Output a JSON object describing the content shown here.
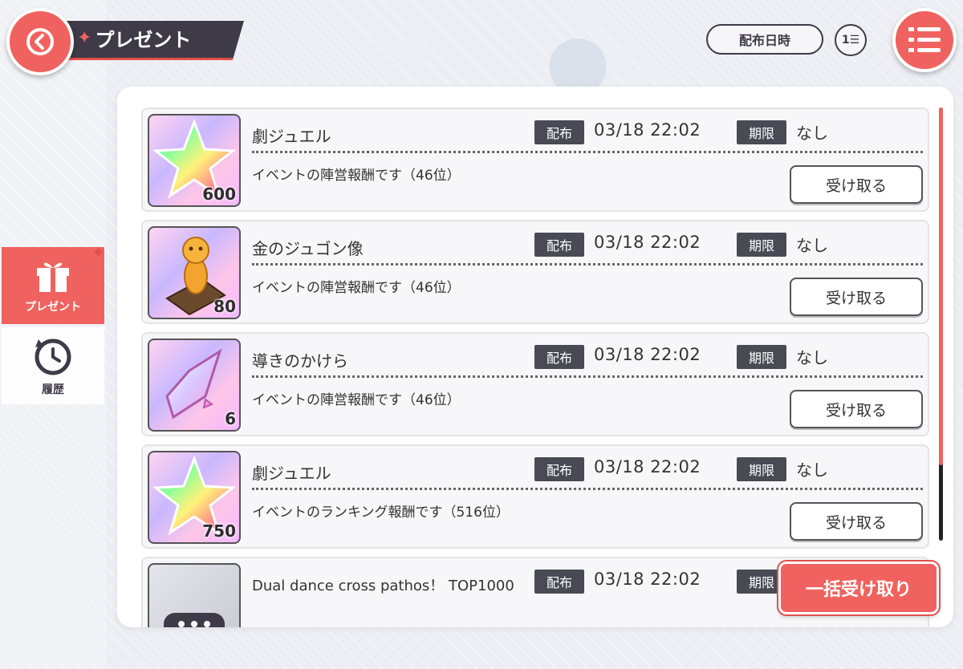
{
  "header": {
    "title": "プレゼント",
    "sort_label": "配布日時",
    "order_label": "1☰"
  },
  "sidebar": {
    "items": [
      {
        "label": "プレゼント",
        "icon": "gift-icon",
        "active": true
      },
      {
        "label": "履歴",
        "icon": "history-icon",
        "active": false
      }
    ]
  },
  "labels": {
    "distribution_tag": "配布",
    "limit_tag": "期限",
    "receive_button": "受け取る",
    "bulk_receive_button": "一括受け取り"
  },
  "presents": [
    {
      "name": "劇ジュエル",
      "quantity": "600",
      "date": "03/18 22:02",
      "limit": "なし",
      "description": "イベントの陣営報酬です（46位）",
      "icon": "star-jewel-icon"
    },
    {
      "name": "金のジュゴン像",
      "quantity": "80",
      "date": "03/18 22:02",
      "limit": "なし",
      "description": "イベントの陣営報酬です（46位）",
      "icon": "gold-dugong-statue-icon"
    },
    {
      "name": "導きのかけら",
      "quantity": "6",
      "date": "03/18 22:02",
      "limit": "なし",
      "description": "イベントの陣営報酬です（46位）",
      "icon": "crystal-shard-icon"
    },
    {
      "name": "劇ジュエル",
      "quantity": "750",
      "date": "03/18 22:02",
      "limit": "なし",
      "description": "イベントのランキング報酬です（516位）",
      "icon": "star-jewel-icon"
    },
    {
      "name": "Dual dance cross pathos！ TOP1000",
      "quantity": "",
      "date": "03/18 22:02",
      "limit": "",
      "description": "",
      "icon": "badge-icon"
    }
  ],
  "colors": {
    "accent": "#f0625f",
    "dark": "#3e3a48"
  }
}
